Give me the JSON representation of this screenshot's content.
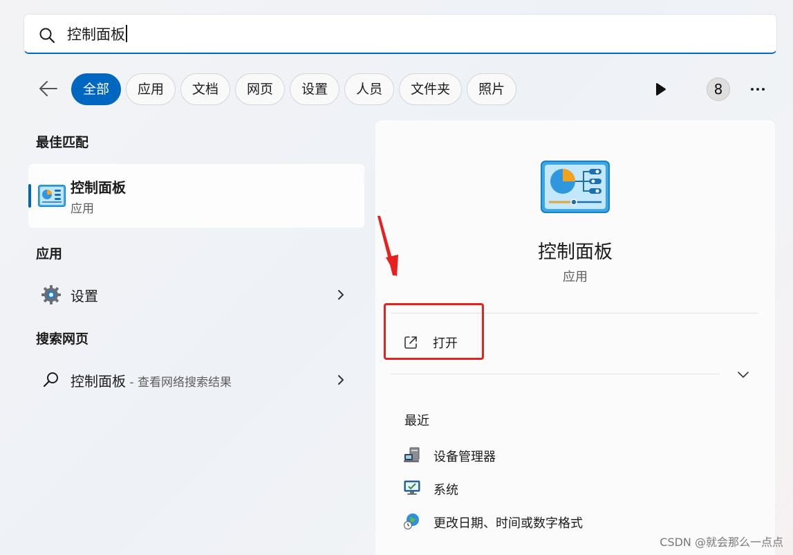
{
  "search": {
    "query": "控制面板"
  },
  "filters": [
    "全部",
    "应用",
    "文档",
    "网页",
    "设置",
    "人员",
    "文件夹",
    "照片"
  ],
  "badge_count": "8",
  "best_match": {
    "section": "最佳匹配",
    "name": "控制面板",
    "type": "应用"
  },
  "apps": {
    "section": "应用",
    "items": [
      {
        "label": "设置"
      }
    ]
  },
  "web": {
    "section": "搜索网页",
    "label": "控制面板",
    "sub": " - 查看网络搜索结果"
  },
  "detail": {
    "title": "控制面板",
    "subtitle": "应用",
    "open_label": "打开",
    "recent_title": "最近",
    "recent": [
      "设备管理器",
      "系统",
      "更改日期、时间或数字格式"
    ]
  },
  "watermark": "CSDN @就会那么一点点",
  "colors": {
    "accent": "#0067c0",
    "annotation": "#e8201e"
  }
}
